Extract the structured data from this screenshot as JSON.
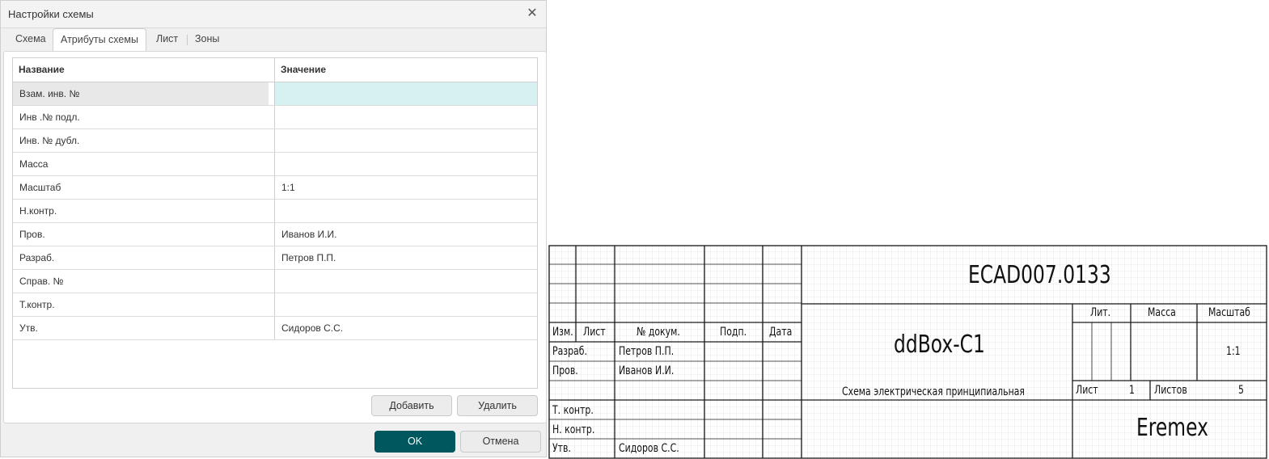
{
  "dialog": {
    "title": "Настройки схемы",
    "tabs": [
      "Схема",
      "Атрибуты схемы",
      "Лист",
      "Зоны"
    ],
    "active_tab": "Атрибуты схемы",
    "columns": {
      "name": "Название",
      "value": "Значение"
    },
    "rows": [
      {
        "name": "Взам. инв. №",
        "value": ""
      },
      {
        "name": "Инв .№ подл.",
        "value": ""
      },
      {
        "name": "Инв. № дубл.",
        "value": ""
      },
      {
        "name": "Масса",
        "value": ""
      },
      {
        "name": "Масштаб",
        "value": "1:1"
      },
      {
        "name": "Н.контр.",
        "value": ""
      },
      {
        "name": "Пров.",
        "value": "Иванов И.И."
      },
      {
        "name": "Разраб.",
        "value": "Петров П.П."
      },
      {
        "name": "Справ. №",
        "value": ""
      },
      {
        "name": "Т.контр.",
        "value": ""
      },
      {
        "name": "Утв.",
        "value": "Сидоров С.С."
      }
    ],
    "buttons": {
      "add": "Добавить",
      "delete": "Удалить",
      "ok": "OK",
      "cancel": "Отмена"
    },
    "accent_color": "#00575d"
  },
  "title_block": {
    "doc_code": "ECAD007.0133",
    "name": "ddBox-C1",
    "doc_type": "Схема электрическая принципиальная",
    "company": "Eremex",
    "headers": {
      "izm": "Изм.",
      "list": "Лист",
      "doc_no": "№ докум.",
      "sign": "Подп.",
      "date": "Дата"
    },
    "roles": {
      "razrab": "Разраб.",
      "prov": "Пров.",
      "tkontr": "Т. контр.",
      "nkontr": "Н. контр.",
      "utv": "Утв."
    },
    "people": {
      "razrab": "Петров П.П.",
      "prov": "Иванов И.И.",
      "utv": "Сидоров С.С."
    },
    "lit_label": "Лит.",
    "mass_label": "Масса",
    "scale_label": "Масштаб",
    "scale_value": "1:1",
    "sheet_label": "Лист",
    "sheet_value": "1",
    "sheets_label": "Листов",
    "sheets_value": "5"
  }
}
